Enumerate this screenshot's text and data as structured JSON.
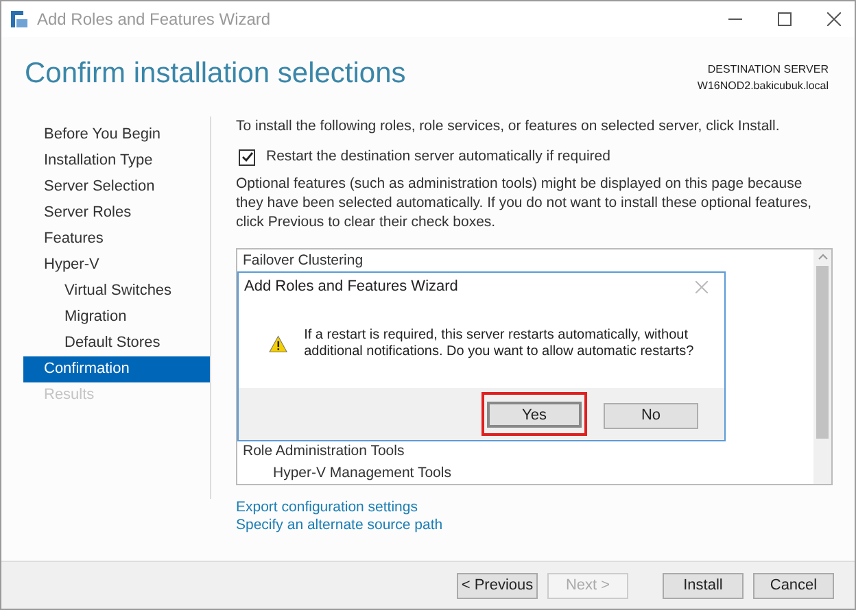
{
  "window": {
    "title": "Add Roles and Features Wizard"
  },
  "header": {
    "title": "Confirm installation selections",
    "server_label": "DESTINATION SERVER",
    "server_name": "W16NOD2.bakicubuk.local"
  },
  "sidebar": {
    "items": [
      {
        "label": "Before You Begin",
        "selected": false,
        "disabled": false
      },
      {
        "label": "Installation Type",
        "selected": false,
        "disabled": false
      },
      {
        "label": "Server Selection",
        "selected": false,
        "disabled": false
      },
      {
        "label": "Server Roles",
        "selected": false,
        "disabled": false
      },
      {
        "label": "Features",
        "selected": false,
        "disabled": false
      },
      {
        "label": "Hyper-V",
        "selected": false,
        "disabled": false,
        "children": [
          {
            "label": "Virtual Switches",
            "selected": false,
            "disabled": false
          },
          {
            "label": "Migration",
            "selected": false,
            "disabled": false
          },
          {
            "label": "Default Stores",
            "selected": false,
            "disabled": false
          }
        ]
      },
      {
        "label": "Confirmation",
        "selected": true,
        "disabled": false
      },
      {
        "label": "Results",
        "selected": false,
        "disabled": true
      }
    ]
  },
  "content": {
    "intro": "To install the following roles, role services, or features on selected server, click Install.",
    "restart_checkbox": {
      "label": "Restart the destination server automatically if required",
      "checked": true
    },
    "note": "Optional features (such as administration tools) might be displayed on this page because they have been selected automatically. If you do not want to install these optional features, click Previous to clear their check boxes.",
    "selections": [
      {
        "label": "Failover Clustering"
      },
      {
        "label": "Role Administration Tools",
        "children": [
          {
            "label": "Hyper-V Management Tools"
          }
        ]
      }
    ],
    "links": [
      "Export configuration settings",
      "Specify an alternate source path"
    ]
  },
  "dialog": {
    "title": "Add Roles and Features Wizard",
    "message": "If a restart is required, this server restarts automatically, without additional notifications. Do you want to allow automatic restarts?",
    "buttons": [
      {
        "label": "Yes",
        "highlighted": true
      },
      {
        "label": "No",
        "highlighted": false
      }
    ]
  },
  "footer": {
    "buttons": [
      {
        "label": "< Previous",
        "disabled": false
      },
      {
        "label": "Next >",
        "disabled": true
      },
      {
        "label": "Install",
        "disabled": false
      },
      {
        "label": "Cancel",
        "disabled": false
      }
    ]
  }
}
